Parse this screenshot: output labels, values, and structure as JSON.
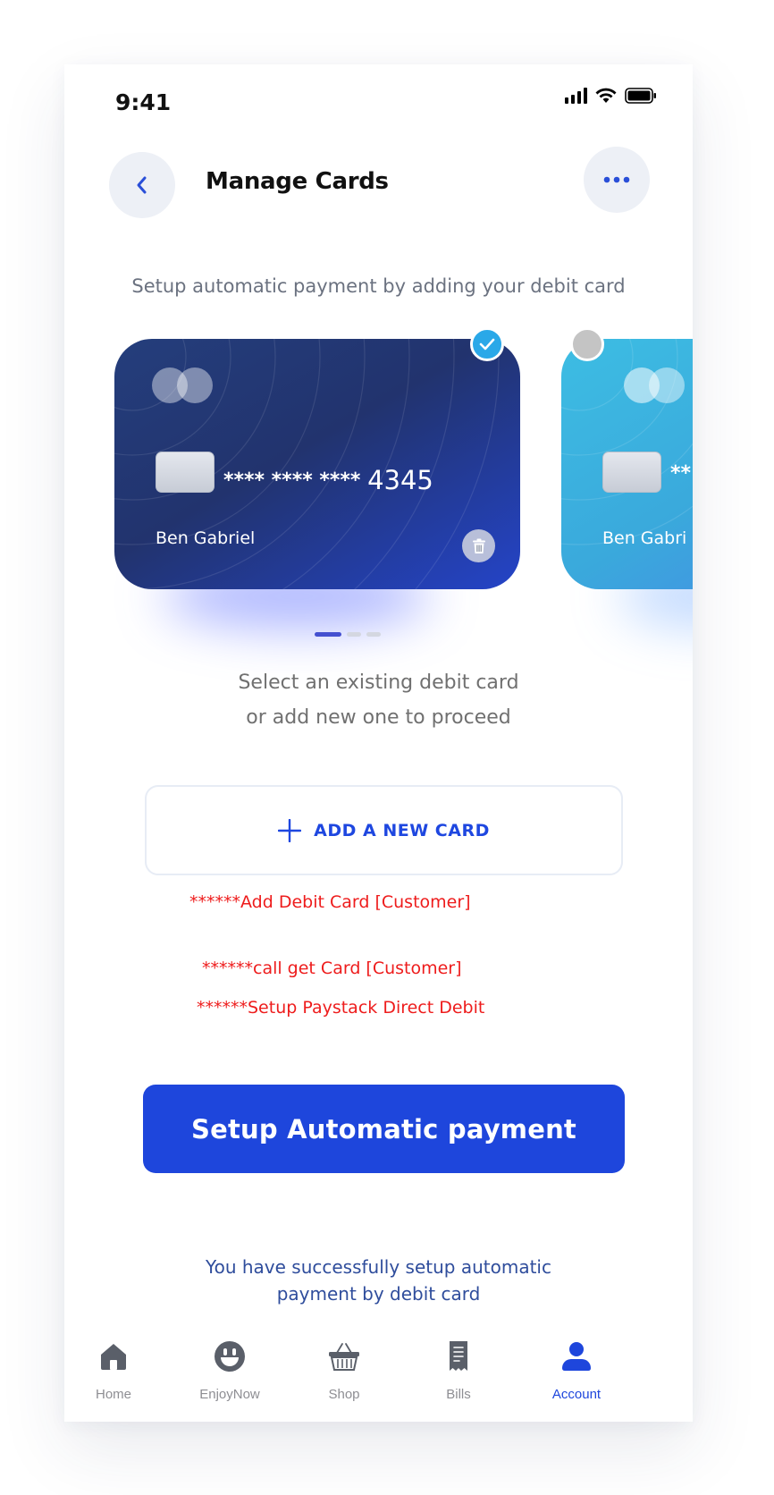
{
  "status_bar": {
    "time": "9:41"
  },
  "header": {
    "title": "Manage Cards"
  },
  "subtitle": "Setup automatic payment by adding your debit card",
  "cards": [
    {
      "masked": "**** **** ****",
      "last4": "4345",
      "holder": "Ben Gabriel",
      "selected": true
    },
    {
      "masked": "**",
      "holder": "Ben Gabri",
      "selected": false
    }
  ],
  "instruction": {
    "line1": "Select an existing debit card",
    "line2": "or add new one to proceed"
  },
  "add_card": {
    "label": "ADD A NEW CARD"
  },
  "notes": [
    "******Add Debit Card [Customer]",
    "******call get Card [Customer]",
    "******Setup Paystack Direct Debit"
  ],
  "primary_button": {
    "label": "Setup Automatic payment"
  },
  "success_message": {
    "line1": "You have successfully setup automatic",
    "line2": "payment by debit card"
  },
  "tab_bar": {
    "items": [
      {
        "label": "Home",
        "icon": "home-icon",
        "active": false
      },
      {
        "label": "EnjoyNow",
        "icon": "smiley-icon",
        "active": false
      },
      {
        "label": "Shop",
        "icon": "basket-icon",
        "active": false
      },
      {
        "label": "Bills",
        "icon": "receipt-icon",
        "active": false
      },
      {
        "label": "Account",
        "icon": "user-icon",
        "active": true
      }
    ]
  },
  "colors": {
    "accent": "#1e46dc",
    "card1": "#243e7c",
    "card2": "#3dbde3",
    "note_red": "#ee1c1c",
    "success_text": "#2f4d9c"
  }
}
